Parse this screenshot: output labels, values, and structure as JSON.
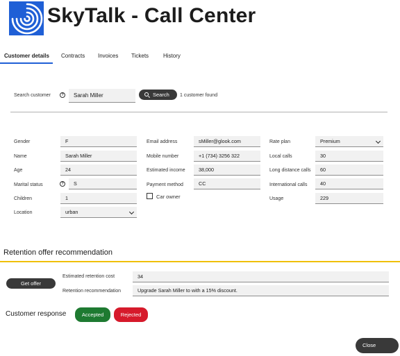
{
  "app": {
    "title": "SkyTalk - Call Center",
    "logo_icon": "skytalk-swirl-logo",
    "brand_color": "#1f5fd6"
  },
  "tabs": [
    {
      "label": "Customer details",
      "active": true
    },
    {
      "label": "Contracts"
    },
    {
      "label": "Invoices"
    },
    {
      "label": "Tickets"
    },
    {
      "label": "History"
    }
  ],
  "search": {
    "label": "Search customer",
    "value": "Sarah Miller",
    "button_label": "Search",
    "result_text": "1 customer found",
    "help_icon": "help-icon"
  },
  "customer": {
    "gender": {
      "label": "Gender",
      "value": "F"
    },
    "name": {
      "label": "Name",
      "value": "Sarah Miller"
    },
    "age": {
      "label": "Age",
      "value": "24"
    },
    "marital_status": {
      "label": "Marital status",
      "value": "S"
    },
    "children": {
      "label": "Children",
      "value": "1"
    },
    "location": {
      "label": "Location",
      "value": "urban"
    },
    "email": {
      "label": "Email address",
      "value": "sMiller@glook.com"
    },
    "mobile": {
      "label": "Mobile number",
      "value": "+1 (734) 3256 322"
    },
    "income": {
      "label": "Estimated income",
      "value": "38,000"
    },
    "payment": {
      "label": "Payment method",
      "value": "CC"
    },
    "car_owner": {
      "label": "Car owner",
      "checked": false
    },
    "rate_plan": {
      "label": "Rate plan",
      "value": "Premium"
    },
    "local_calls": {
      "label": "Local calls",
      "value": "30"
    },
    "long_distance": {
      "label": "Long distance calls",
      "value": "60"
    },
    "international": {
      "label": "International calls",
      "value": "40"
    },
    "usage": {
      "label": "Usage",
      "value": "229"
    }
  },
  "retention": {
    "title": "Retention offer recommendation",
    "get_offer_label": "Get offer",
    "cost_label": "Estimated retention cost",
    "cost_value": "34",
    "recommendation_label": "Retention recommendation",
    "recommendation_value": "Upgrade Sarah Miller to  with a 15% discount.",
    "accent_color": "#f0c000"
  },
  "response": {
    "label": "Customer response",
    "accepted_label": "Accepted",
    "rejected_label": "Rejected",
    "accepted_color": "#1e7a31",
    "rejected_color": "#d61a2b"
  },
  "footer": {
    "close_label": "Close"
  }
}
